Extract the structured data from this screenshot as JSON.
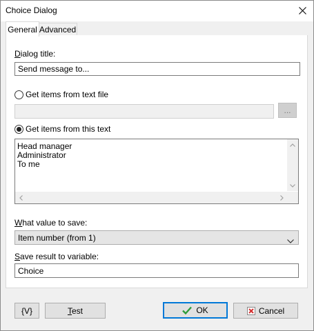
{
  "window": {
    "title": "Choice Dialog",
    "close_glyph": "✕"
  },
  "tabs": [
    {
      "label": "General",
      "active": true
    },
    {
      "label": "Advanced",
      "active": false
    }
  ],
  "dialog_title": {
    "label_first": "D",
    "label_rest": "ialog title:",
    "value": "Send message to..."
  },
  "source": {
    "from_file_label": "Get items from text file",
    "file_value": "",
    "browse_label": "...",
    "from_text_label": "Get items from this text",
    "selected": "from_text",
    "items": [
      "Head manager",
      "Administrator",
      "To me"
    ]
  },
  "save_value": {
    "label_first": "W",
    "label_rest": "hat value to save:",
    "selected": "Item number (from 1)"
  },
  "variable": {
    "label_first": "S",
    "label_rest": "ave result to variable:",
    "value": "Choice"
  },
  "buttons": {
    "var_label": "{V}",
    "test_first": "T",
    "test_rest": "est",
    "ok_label": "OK",
    "cancel_label": "Cancel"
  },
  "colors": {
    "ok_check": "#2e9c3a",
    "cancel_x": "#d32f2f",
    "focus_border": "#0078d7"
  }
}
